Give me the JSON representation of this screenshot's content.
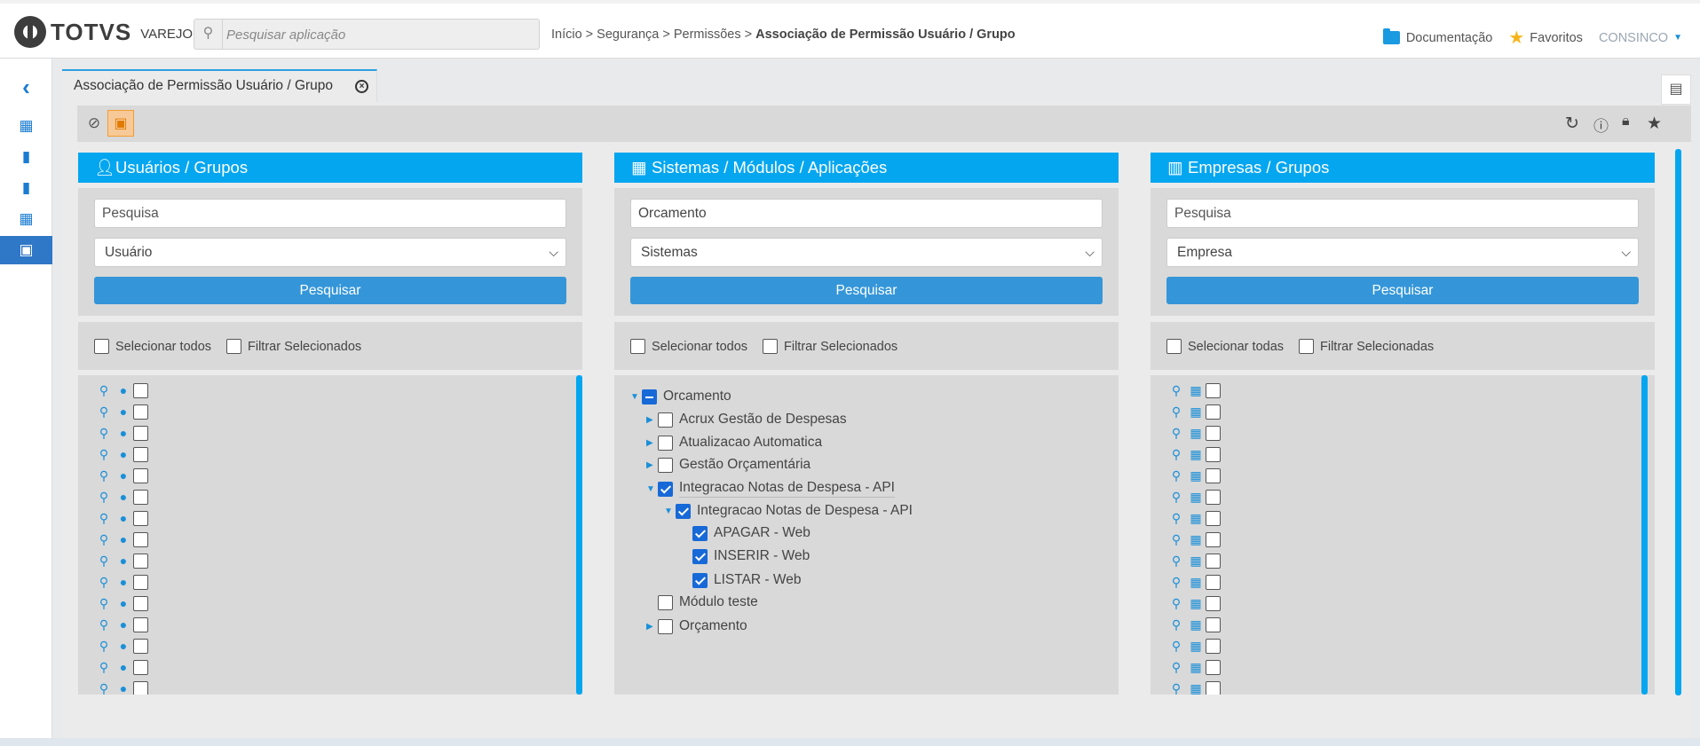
{
  "header": {
    "brand": "TOTVS",
    "brand_sub": "VAREJO",
    "search_placeholder": "Pesquisar aplicação",
    "breadcrumb": "Início > Segurança > Permissões > ",
    "breadcrumb_current": "Associação de Permissão Usuário / Grupo",
    "docs": "Documentação",
    "favorites": "Favoritos",
    "user": "CONSINCO"
  },
  "tab": {
    "title": "Associação de Permissão Usuário / Grupo"
  },
  "panels": {
    "users": {
      "title": "Usuários / Grupos",
      "search_placeholder": "Pesquisa",
      "select": "Usuário",
      "button": "Pesquisar",
      "select_all": "Selecionar todos",
      "filter": "Filtrar Selecionados"
    },
    "systems": {
      "title": "Sistemas / Módulos / Aplicações",
      "search_value": "Orcamento",
      "select": "Sistemas",
      "button": "Pesquisar",
      "select_all": "Selecionar todos",
      "filter": "Filtrar Selecionados",
      "tree": {
        "root": "Orcamento",
        "n1": "Acrux Gestão de Despesas",
        "n2": "Atualizacao Automatica",
        "n3": "Gestão Orçamentária",
        "n4": "Integracao Notas de Despesa - API",
        "n4a": "Integracao Notas de Despesa - API",
        "n4a1": "APAGAR - Web",
        "n4a2": "INSERIR - Web",
        "n4a3": "LISTAR - Web",
        "n5": "Módulo teste",
        "n6": "Orçamento"
      }
    },
    "companies": {
      "title": "Empresas / Grupos",
      "search_placeholder": "Pesquisa",
      "select": "Empresa",
      "button": "Pesquisar",
      "select_all": "Selecionar todas",
      "filter": "Filtrar Selecionadas"
    }
  }
}
